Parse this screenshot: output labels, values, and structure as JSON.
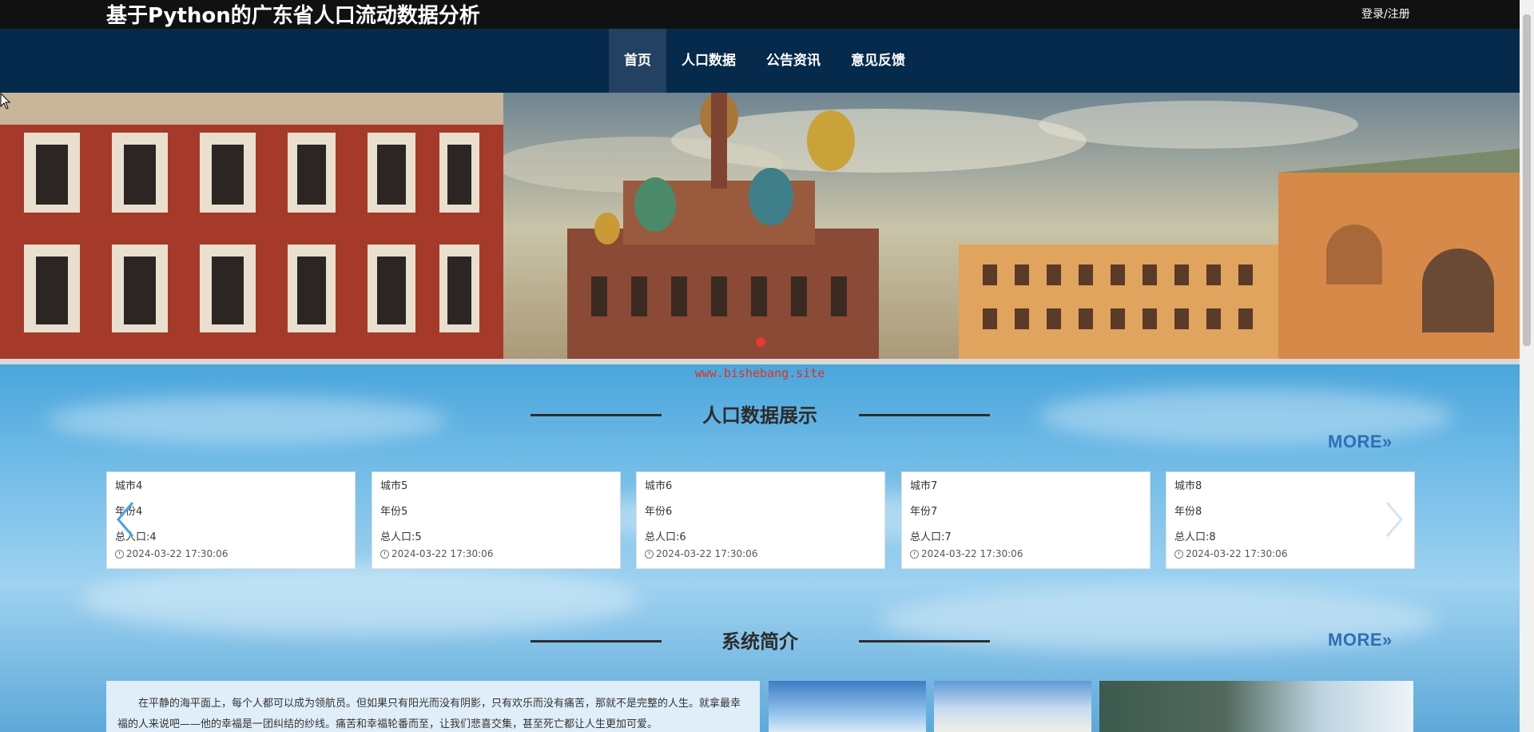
{
  "header": {
    "title": "基于Python的广东省人口流动数据分析",
    "login": "登录/注册"
  },
  "nav": {
    "items": [
      "首页",
      "人口数据",
      "公告资讯",
      "意见反馈"
    ],
    "active_index": 0
  },
  "banner": {
    "slide_count": 1,
    "active_slide": 0
  },
  "watermark": "www.bishebang.site",
  "population_section": {
    "title": "人口数据展示",
    "more": "MORE»",
    "cards": [
      {
        "city": "城市4",
        "year": "年份4",
        "total": "总人口:4",
        "time": "2024-03-22 17:30:06"
      },
      {
        "city": "城市5",
        "year": "年份5",
        "total": "总人口:5",
        "time": "2024-03-22 17:30:06"
      },
      {
        "city": "城市6",
        "year": "年份6",
        "total": "总人口:6",
        "time": "2024-03-22 17:30:06"
      },
      {
        "city": "城市7",
        "year": "年份7",
        "total": "总人口:7",
        "time": "2024-03-22 17:30:06"
      },
      {
        "city": "城市8",
        "year": "年份8",
        "total": "总人口:8",
        "time": "2024-03-22 17:30:06"
      }
    ]
  },
  "intro_section": {
    "title": "系统简介",
    "more": "MORE»",
    "text": "在平静的海平面上，每个人都可以成为领航员。但如果只有阳光而没有阴影，只有欢乐而没有痛苦，那就不是完整的人生。就拿最幸福的人来说吧——他的幸福是一团纠结的纱线。痛苦和幸福轮番而至，让我们悲喜交集，甚至死亡都让人生更加可爱。"
  },
  "colors": {
    "topbar": "#111111",
    "nav": "#062a4c",
    "nav_active": "#234261",
    "accent_more": "#2f6fb5",
    "watermark": "#e3301f"
  }
}
